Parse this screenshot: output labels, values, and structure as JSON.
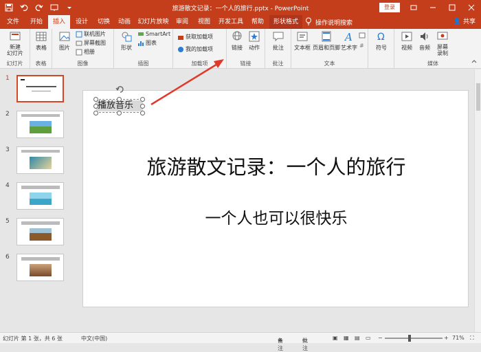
{
  "titlebar": {
    "title": "旅游散文记录：一个人的旅行.pptx  -  PowerPoint",
    "login": "登录",
    "accent": "#c43e1c"
  },
  "tabs": [
    {
      "label": "文件"
    },
    {
      "label": "开始"
    },
    {
      "label": "插入"
    },
    {
      "label": "设计"
    },
    {
      "label": "切换"
    },
    {
      "label": "动画"
    },
    {
      "label": "幻灯片放映"
    },
    {
      "label": "审阅"
    },
    {
      "label": "视图"
    },
    {
      "label": "开发工具"
    },
    {
      "label": "帮助"
    },
    {
      "label": "形状格式"
    }
  ],
  "search_label": "操作说明搜索",
  "share_label": "共享",
  "ribbon": {
    "groups": [
      {
        "label": "幻灯片"
      },
      {
        "label": "表格"
      },
      {
        "label": "图像"
      },
      {
        "label": "插图"
      },
      {
        "label": "加载项"
      },
      {
        "label": "链接"
      },
      {
        "label": "批注"
      },
      {
        "label": "文本"
      },
      {
        "label": "媒体"
      }
    ],
    "new_slide": "新建\n幻灯片",
    "table": "表格",
    "pictures": "图片",
    "online_pictures": "联机图片",
    "screenshot": "屏幕截图",
    "album": "相册",
    "shapes": "形状",
    "smartart": "SmartArt",
    "chart": "图表",
    "get_addins": "获取加载项",
    "my_addins": "我的加载项",
    "link": "链接",
    "action": "动作",
    "comment": "批注",
    "textbox": "文本框",
    "header_footer": "页眉和页脚",
    "wordart": "艺术字",
    "symbol": "符号",
    "video": "视频",
    "audio": "音频",
    "screen_record": "屏幕\n录制"
  },
  "thumbnails": [
    {
      "num": "1"
    },
    {
      "num": "2"
    },
    {
      "num": "3"
    },
    {
      "num": "4"
    },
    {
      "num": "5"
    },
    {
      "num": "6"
    }
  ],
  "slide": {
    "title": "旅游散文记录：一个人的旅行",
    "subtitle": "一个人也可以很快乐",
    "shape_text": "播放音乐"
  },
  "statusbar": {
    "slide_info": "幻灯片 第 1 张，共 6 张",
    "language": "中文(中国)",
    "notes": "备注",
    "comments": "批注",
    "zoom": "71%"
  }
}
